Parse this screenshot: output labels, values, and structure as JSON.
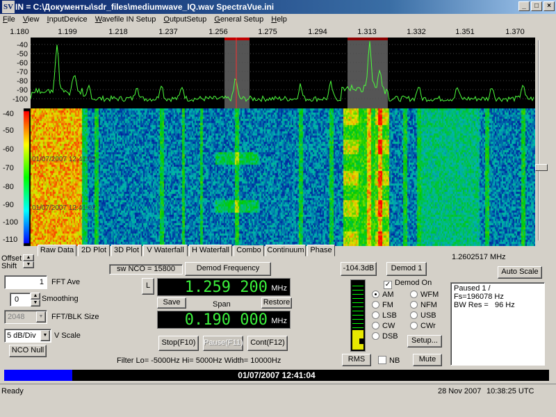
{
  "window": {
    "title": "IN = C:\\Документы\\sdr_files\\mediumwave_IQ.wav    SpectraVue.ini",
    "icon_text": "SV",
    "controls": [
      "_",
      "□",
      "×"
    ]
  },
  "menu": [
    "File",
    "View",
    "InputDevice",
    "Wavefile IN Setup",
    "OutputSetup",
    "General Setup",
    "Help"
  ],
  "spectrum": {
    "freq_ticks": [
      "1.180",
      "1.199",
      "1.218",
      "1.237",
      "1.256",
      "1.275",
      "1.294",
      "1.313",
      "1.332",
      "1.351",
      "1.370"
    ],
    "db_ticks": [
      "-40",
      "-50",
      "-60",
      "-70",
      "-80",
      "-90",
      "-100"
    ],
    "trace_color": "#4cff3c"
  },
  "waterfall": {
    "db_ticks": [
      "-40",
      "-50",
      "-60",
      "-70",
      "-80",
      "-90",
      "-100",
      "-110"
    ],
    "timestamps": [
      "01/07/2007 12:41:03",
      "01/07/2007 12:41:02"
    ]
  },
  "tabs": [
    "Raw Data",
    "2D Plot",
    "3D Plot",
    "V Waterfall",
    "H Waterfall",
    "Combo",
    "Continuum",
    "Phase"
  ],
  "selected_tab": "Combo",
  "left_panel": {
    "offset_label": "Offset",
    "shift_label": "Shift",
    "fft_ave_value": "1",
    "fft_ave_label": "FFT Ave",
    "smoothing_value": "0",
    "smoothing_label": "Smoothing",
    "fft_blk_value": "2048",
    "fft_blk_label": "FFT/BLK Size",
    "vscale_value": "5 dB/Div",
    "vscale_label": "V Scale",
    "nco_null_label": "NCO Null"
  },
  "center_panel": {
    "sw_nco": "sw NCO = 15800",
    "demod_freq_button": "Demod Frequency",
    "l_button": "L",
    "freq_display": "1.259 200",
    "freq_unit": "MHz",
    "save_button": "Save",
    "span_label": "Span",
    "restore_button": "Restore",
    "span_display": "0.190 000",
    "span_unit": "MHz",
    "stop_button": "Stop(F10)",
    "pause_button": "Pause(F11)",
    "cont_button": "Cont(F12)",
    "filter_text": "Filter  Lo= -5000Hz  Hi= 5000Hz  Width= 10000Hz"
  },
  "demod_panel": {
    "level_readout": "-104.3dB",
    "demod_button": "Demod 1",
    "demod_on_label": "Demod On",
    "demod_on_checked": true,
    "modes": [
      "AM",
      "WFM",
      "FM",
      "NFM",
      "LSB",
      "USB",
      "CW",
      "CWr",
      "DSB"
    ],
    "selected_mode": "AM",
    "setup_button": "Setup...",
    "rms_button": "RMS",
    "nb_label": "NB",
    "mute_button": "Mute"
  },
  "right_panel": {
    "cursor_freq": "1.2602517 MHz",
    "autoscale_button": "Auto Scale",
    "info_lines": [
      "Paused 1  /",
      "Fs=196078 Hz",
      "BW Res =   96 Hz"
    ]
  },
  "progress": {
    "fraction": 0.125,
    "timestamp": "01/07/2007 12:41:04"
  },
  "statusbar": {
    "status": "Ready",
    "date": "28 Nov 2007",
    "time": "10:38:25 UTC"
  }
}
